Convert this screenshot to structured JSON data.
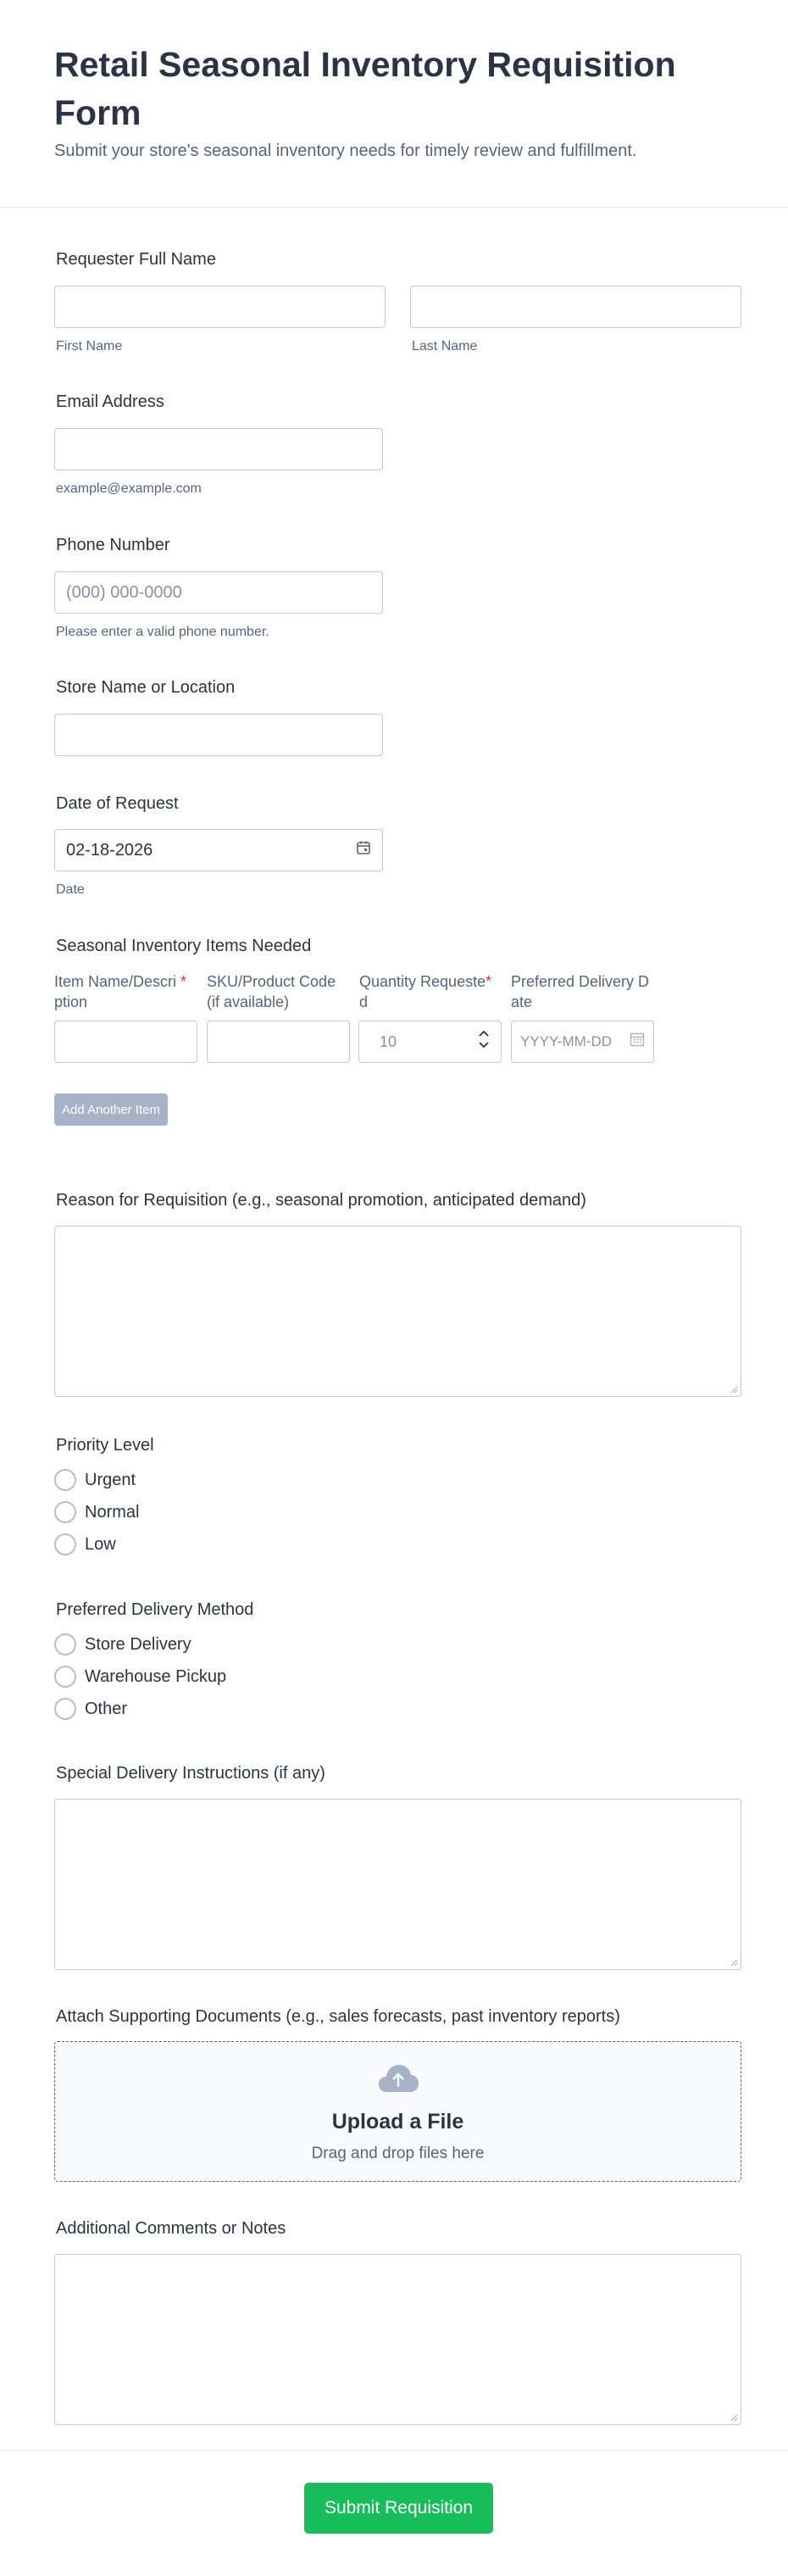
{
  "form": {
    "title": "Retail Seasonal Inventory Requisition Form",
    "subtitle": "Submit your store's seasonal inventory needs for timely review and fulfillment."
  },
  "name": {
    "label": "Requester Full Name",
    "first_sublabel": "First Name",
    "last_sublabel": "Last Name",
    "first_value": "",
    "last_value": ""
  },
  "email": {
    "label": "Email Address",
    "sublabel": "example@example.com",
    "value": ""
  },
  "phone": {
    "label": "Phone Number",
    "placeholder": "(000) 000-0000",
    "sublabel": "Please enter a valid phone number."
  },
  "store": {
    "label": "Store Name or Location",
    "value": ""
  },
  "date": {
    "label": "Date of Request",
    "value": "02-18-2026",
    "sublabel": "Date",
    "icon": "calendar-icon"
  },
  "items": {
    "label": "Seasonal Inventory Items Needed",
    "columns": [
      {
        "line1": "Item Name/Descri",
        "line2": "ption",
        "required": true
      },
      {
        "line1": "SKU/Product Code",
        "line2": "(if available)",
        "required": false
      },
      {
        "line1": "Quantity Requeste",
        "line2": "d",
        "required": true
      },
      {
        "line1": "Preferred Delivery D",
        "line2": "ate",
        "required": false
      }
    ],
    "required_mark": "*",
    "quantity_placeholder": "10",
    "date_placeholder": "YYYY-MM-DD",
    "add_button": "Add Another Item"
  },
  "reason": {
    "label": "Reason for Requisition (e.g., seasonal promotion, anticipated demand)"
  },
  "priority": {
    "label": "Priority Level",
    "options": [
      "Urgent",
      "Normal",
      "Low"
    ]
  },
  "delivery_method": {
    "label": "Preferred Delivery Method",
    "options": [
      "Store Delivery",
      "Warehouse Pickup",
      "Other"
    ]
  },
  "instructions": {
    "label": "Special Delivery Instructions (if any)"
  },
  "attach": {
    "label": "Attach Supporting Documents (e.g., sales forecasts, past inventory reports)",
    "upload_title": "Upload a File",
    "upload_sub": "Drag and drop files here",
    "icon": "cloud-upload-icon"
  },
  "comments": {
    "label": "Additional Comments or Notes"
  },
  "submit": {
    "label": "Submit Requisition"
  },
  "colors": {
    "accent": "#18bd5b",
    "border": "#c3cad8",
    "text": "#2c3345",
    "muted": "#57647e",
    "required": "#c2412d",
    "add_button": "#a8b2c6"
  }
}
